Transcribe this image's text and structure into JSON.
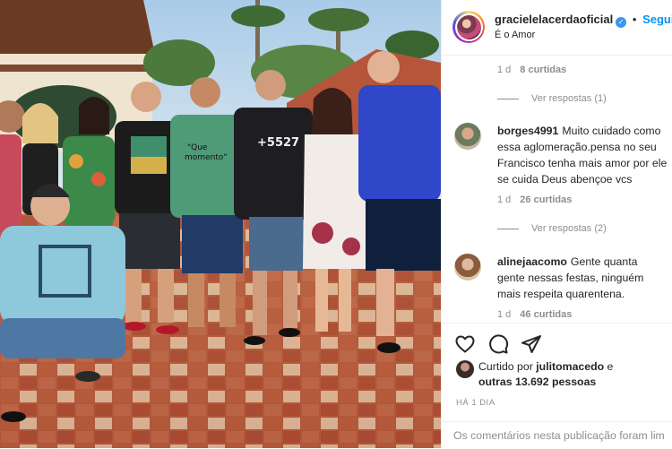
{
  "post": {
    "owner": "gracielelacerdaoficial",
    "verified_icon": "verified-badge-icon",
    "separator": "•",
    "follow_label": "Seguir",
    "location": "É o Amor"
  },
  "photo": {
    "shirt_text_1": "\"Que",
    "shirt_text_2": "momento\"",
    "shirt_text_3": "+5527"
  },
  "thread": {
    "first_meta": {
      "age": "1 d",
      "likes": "8 curtidas"
    },
    "first_replies": "Ver respostas (1)",
    "comments": [
      {
        "user": "borges4991",
        "text": "Muito cuidado como essa aglomeração.pensa no seu Francisco tenha mais amor por ele se cuida Deus abençoe vcs",
        "age": "1 d",
        "likes": "26 curtidas",
        "replies": "Ver respostas (2)"
      },
      {
        "user": "alinejaacomo",
        "text": "Gente quanta gente nessas festas, ninguém mais respeita quarentena.",
        "age": "1 d",
        "likes": "46 curtidas"
      }
    ]
  },
  "actions": {
    "like_icon": "heart-icon",
    "comment_icon": "comment-icon",
    "share_icon": "share-icon",
    "liked_prefix": "Curtido por",
    "liked_by": "julitomacedo",
    "liked_and": "e",
    "others": "outras 13.692 pessoas",
    "time": "HÁ 1 DIA"
  },
  "footer": {
    "text": "Os comentários nesta publicação foram lim"
  },
  "colors": {
    "accent": "#0095f6",
    "muted": "#8e8e8e",
    "text": "#262626"
  }
}
